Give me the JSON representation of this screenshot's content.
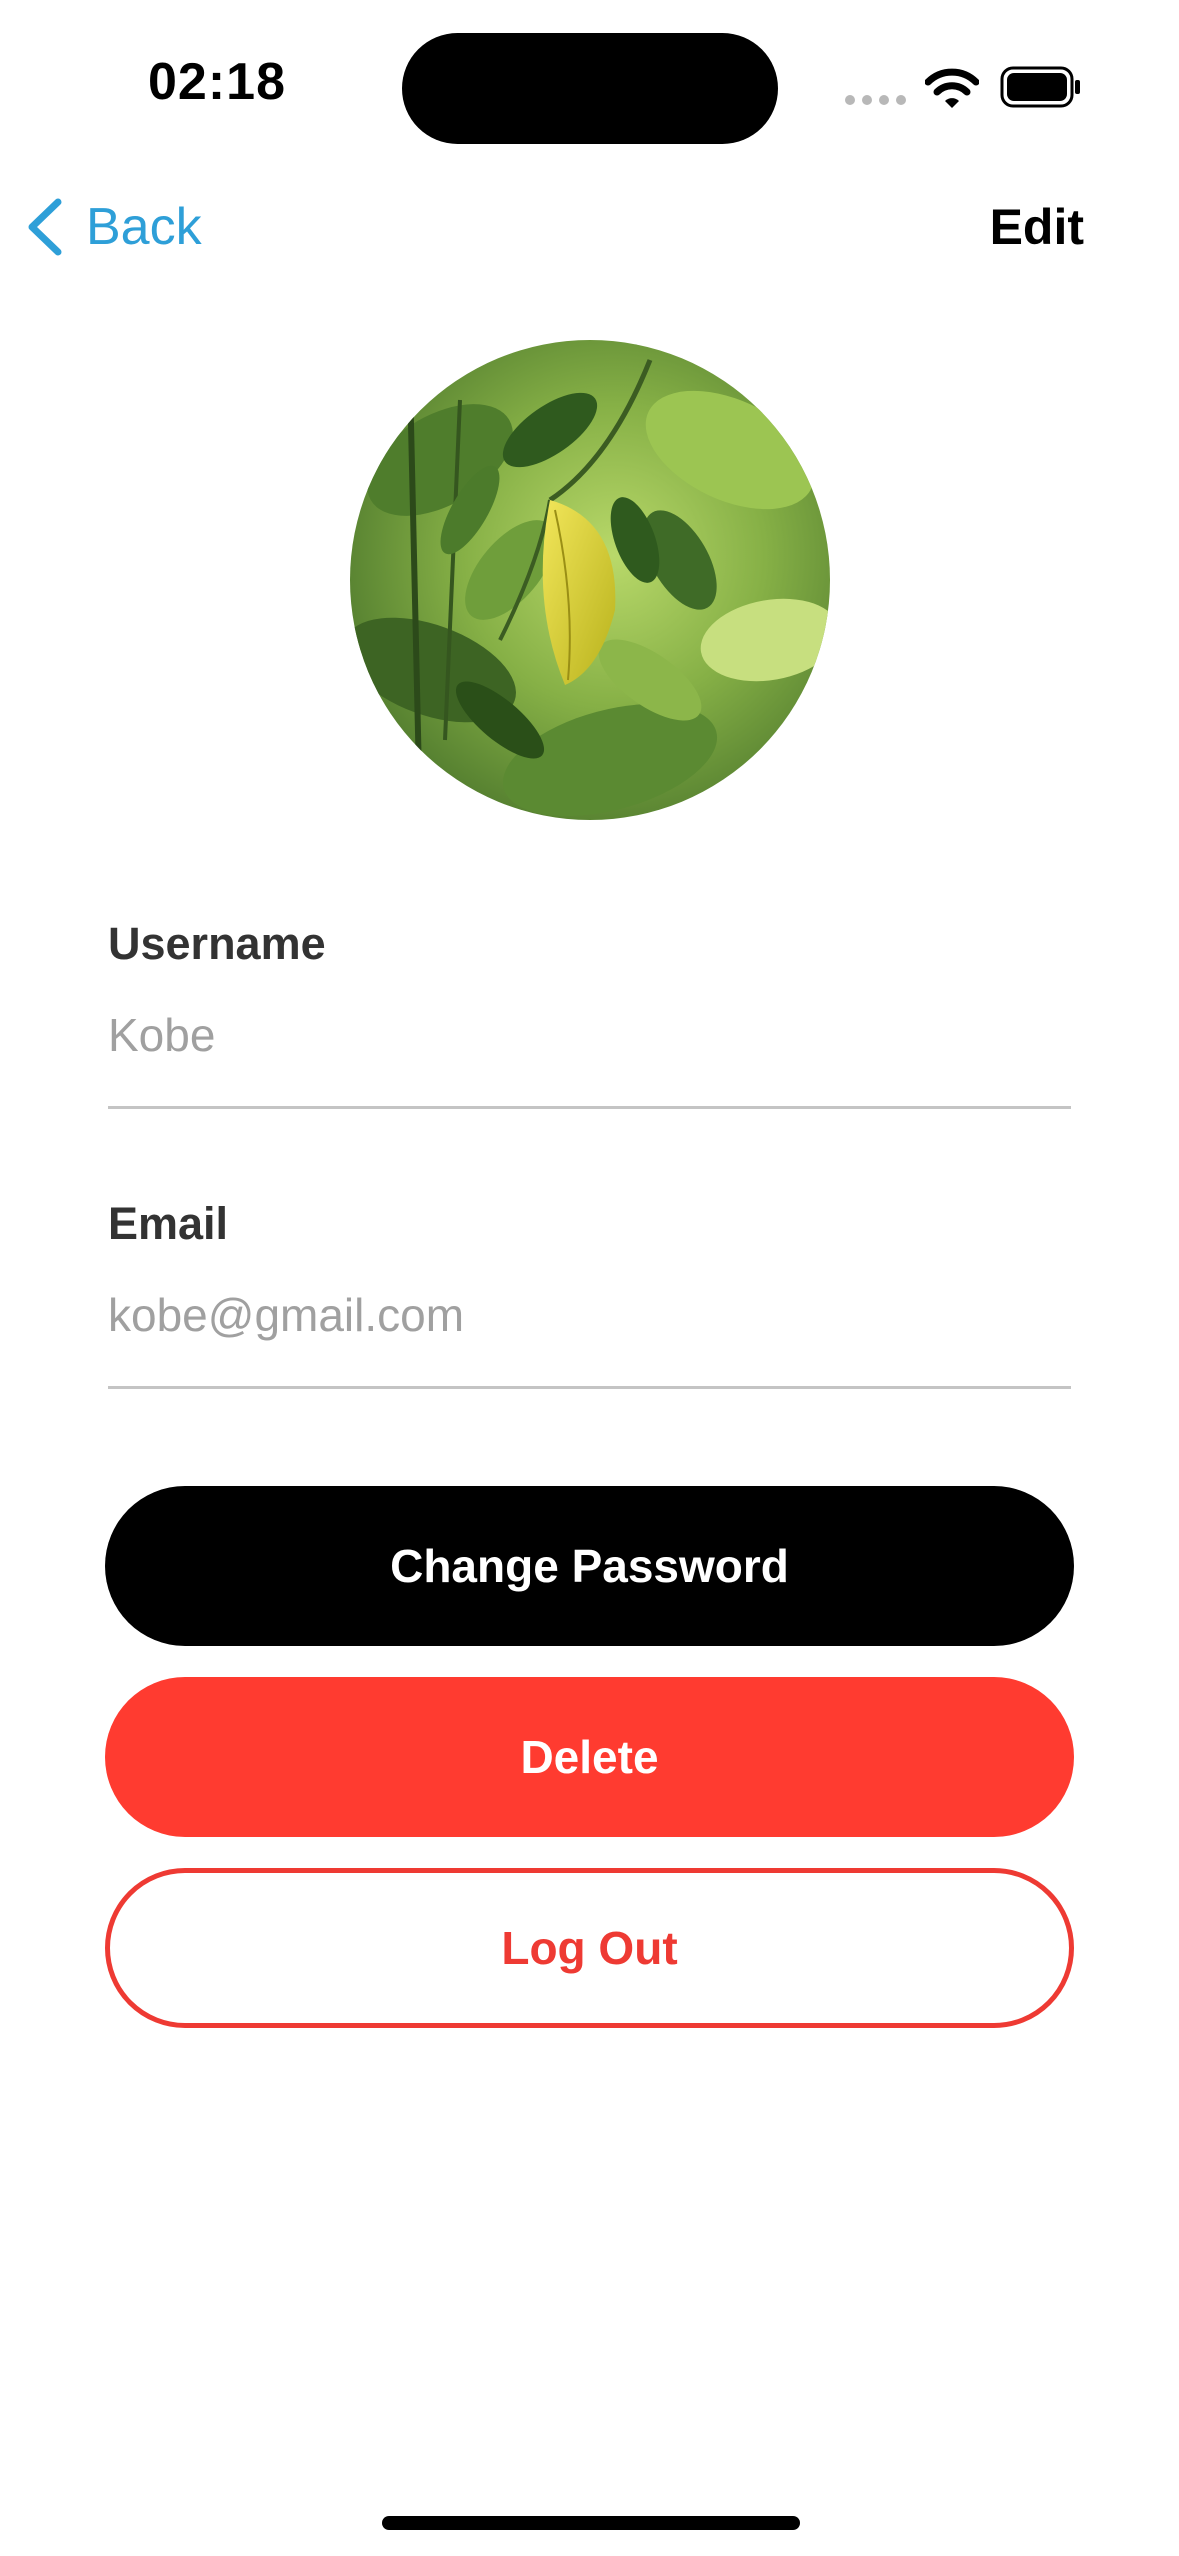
{
  "status_bar": {
    "time": "02:18",
    "icons": [
      "signal-icon",
      "wifi-icon",
      "battery-icon"
    ]
  },
  "nav": {
    "back_label": "Back",
    "edit_label": "Edit",
    "accent_color": "#2e9fd8"
  },
  "profile": {
    "avatar": "leaf-photo"
  },
  "form": {
    "username": {
      "label": "Username",
      "placeholder": "Kobe"
    },
    "email": {
      "label": "Email",
      "placeholder": "kobe@gmail.com"
    }
  },
  "buttons": {
    "change_password": "Change Password",
    "delete": "Delete",
    "log_out": "Log Out"
  },
  "colors": {
    "primary_button": "#000000",
    "destructive": "#ff3b30",
    "outline_destructive": "#ee3a33"
  }
}
